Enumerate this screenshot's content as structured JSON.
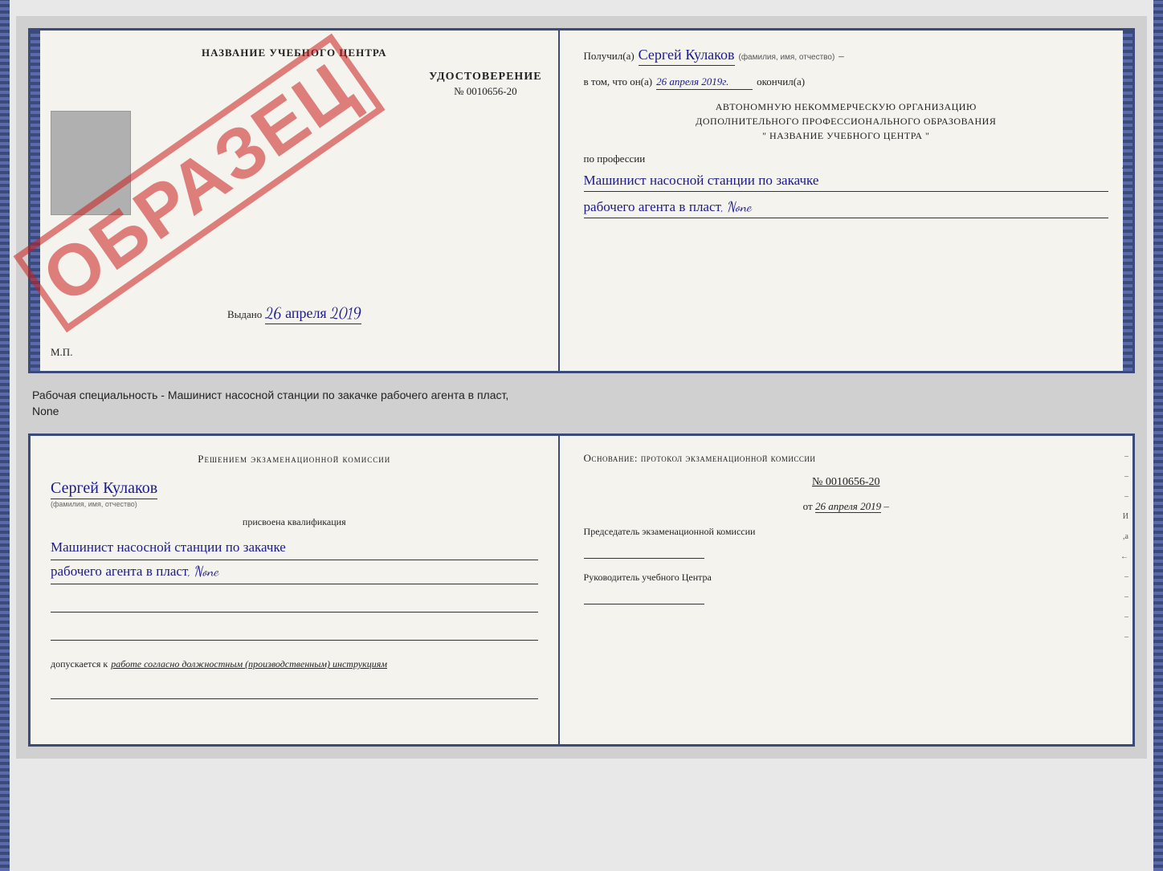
{
  "cert": {
    "left": {
      "title": "НАЗВАНИЕ УЧЕБНОГО ЦЕНТРА",
      "stamp": "ОБРАЗЕЦ",
      "udost_label": "УДОСТОВЕРЕНИЕ",
      "udost_number": "№ 0010656-20",
      "vydano_label": "Выдано",
      "vydano_date": "26 апреля 2019",
      "mp": "М.П."
    },
    "right": {
      "poluchil_label": "Получил(а)",
      "poluchil_name": "Сергей Кулаков",
      "poluchil_sub": "(фамилия, имя, отчество)",
      "vtom_label": "в том, что он(а)",
      "vtom_date": "26 апреля 2019г.",
      "okonchil_label": "окончил(а)",
      "org_line1": "АВТОНОМНУЮ НЕКОММЕРЧЕСКУЮ ОРГАНИЗАЦИЮ",
      "org_line2": "ДОПОЛНИТЕЛЬНОГО ПРОФЕССИОНАЛЬНОГО ОБРАЗОВАНИЯ",
      "org_line3": "\" НАЗВАНИЕ УЧЕБНОГО ЦЕНТРА \"",
      "po_professii": "по профессии",
      "prof_line1": "Машинист насосной станции по закачке",
      "prof_line2": "рабочего агента в пласт, None"
    }
  },
  "specialty_text": {
    "line1": "Рабочая специальность - Машинист насосной станции по закачке рабочего агента в пласт,",
    "line2": "None"
  },
  "bottom": {
    "left": {
      "commission_text": "Решением экзаменационной комиссии",
      "person_name": "Сергей Кулаков",
      "person_sub": "(фамилия, имя, отчество)",
      "prisvoena": "присвоена квалификация",
      "qual_line1": "Машинист насосной станции по закачке",
      "qual_line2": "рабочего агента в пласт, None",
      "dopusk_label": "допускается к",
      "dopusk_text": "работе согласно должностным (производственным) инструкциям"
    },
    "right": {
      "osnovanie_label": "Основание: протокол экзаменационной комиссии",
      "protocol_number": "№ 0010656-20",
      "ot_label": "от",
      "protocol_date": "26 апреля 2019",
      "predsedatel_label": "Председатель экзаменационной комиссии",
      "rukovoditel_label": "Руководитель учебного Центра"
    }
  },
  "dashes": [
    "-",
    "-",
    "-",
    "-",
    "-",
    "И",
    ",а",
    "←",
    "-",
    "-",
    "-",
    "-"
  ]
}
